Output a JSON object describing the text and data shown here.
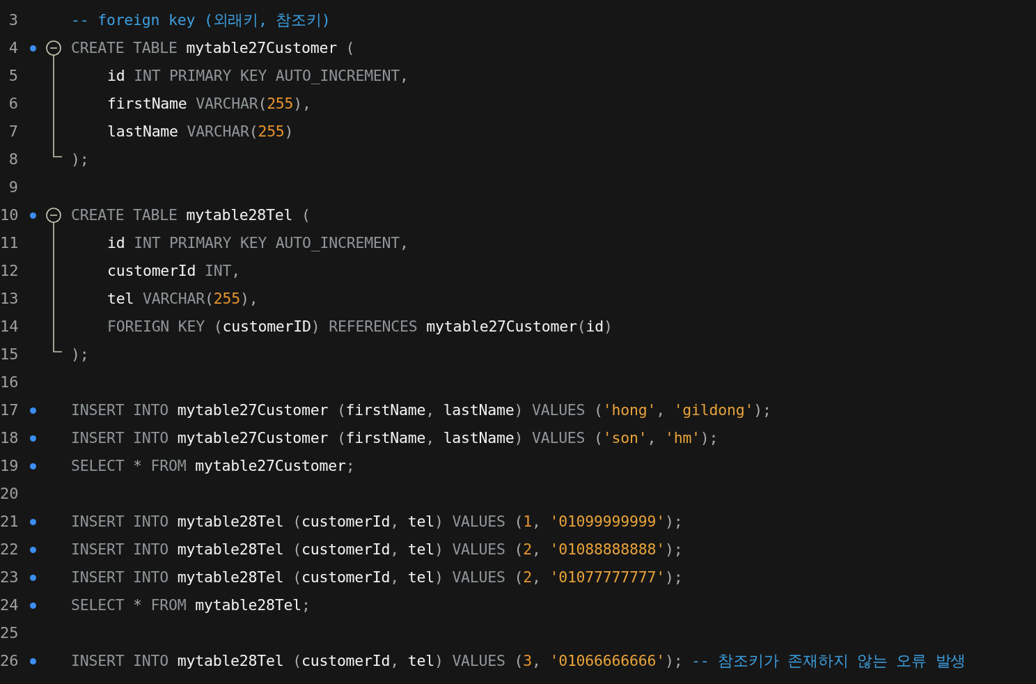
{
  "lines": [
    {
      "number": "3",
      "kind": "plain",
      "statement": false,
      "tokens": [
        {
          "kind": "comment",
          "t": "-- foreign key (외래키, 참조키)"
        }
      ]
    },
    {
      "number": "4",
      "kind": "fold-start",
      "statement": true,
      "tokens": [
        {
          "kind": "kw",
          "t": "CREATE TABLE "
        },
        {
          "kind": "id",
          "t": "mytable27Customer "
        },
        {
          "kind": "p",
          "t": "("
        }
      ]
    },
    {
      "number": "5",
      "kind": "fold-body",
      "statement": false,
      "tokens": [
        {
          "kind": "id",
          "t": "id "
        },
        {
          "kind": "kw",
          "t": "INT PRIMARY KEY AUTO_INCREMENT"
        },
        {
          "kind": "p",
          "t": ","
        }
      ]
    },
    {
      "number": "6",
      "kind": "fold-body",
      "statement": false,
      "tokens": [
        {
          "kind": "id",
          "t": "firstName "
        },
        {
          "kind": "kw",
          "t": "VARCHAR"
        },
        {
          "kind": "p",
          "t": "("
        },
        {
          "kind": "num",
          "t": "255"
        },
        {
          "kind": "p",
          "t": "),"
        }
      ]
    },
    {
      "number": "7",
      "kind": "fold-body",
      "statement": false,
      "tokens": [
        {
          "kind": "id",
          "t": "lastName "
        },
        {
          "kind": "kw",
          "t": "VARCHAR"
        },
        {
          "kind": "p",
          "t": "("
        },
        {
          "kind": "num",
          "t": "255"
        },
        {
          "kind": "p",
          "t": ")"
        }
      ]
    },
    {
      "number": "8",
      "kind": "fold-end",
      "statement": false,
      "tokens": [
        {
          "kind": "p",
          "t": ");"
        }
      ]
    },
    {
      "number": "9",
      "kind": "plain",
      "statement": false
    },
    {
      "number": "10",
      "kind": "fold-start",
      "statement": true,
      "tokens": [
        {
          "kind": "kw",
          "t": "CREATE TABLE "
        },
        {
          "kind": "id",
          "t": "mytable28Tel "
        },
        {
          "kind": "p",
          "t": "("
        }
      ]
    },
    {
      "number": "11",
      "kind": "fold-body",
      "statement": false,
      "tokens": [
        {
          "kind": "id",
          "t": "id "
        },
        {
          "kind": "kw",
          "t": "INT PRIMARY KEY AUTO_INCREMENT"
        },
        {
          "kind": "p",
          "t": ","
        }
      ]
    },
    {
      "number": "12",
      "kind": "fold-body",
      "statement": false,
      "tokens": [
        {
          "kind": "id",
          "t": "customerId "
        },
        {
          "kind": "kw",
          "t": "INT"
        },
        {
          "kind": "p",
          "t": ","
        }
      ]
    },
    {
      "number": "13",
      "kind": "fold-body",
      "statement": false,
      "tokens": [
        {
          "kind": "id",
          "t": "tel "
        },
        {
          "kind": "kw",
          "t": "VARCHAR"
        },
        {
          "kind": "p",
          "t": "("
        },
        {
          "kind": "num",
          "t": "255"
        },
        {
          "kind": "p",
          "t": "),"
        }
      ]
    },
    {
      "number": "14",
      "kind": "fold-body",
      "statement": false,
      "tokens": [
        {
          "kind": "kw",
          "t": "FOREIGN KEY "
        },
        {
          "kind": "p",
          "t": "("
        },
        {
          "kind": "id",
          "t": "customerID"
        },
        {
          "kind": "p",
          "t": ") "
        },
        {
          "kind": "kw",
          "t": "REFERENCES "
        },
        {
          "kind": "id",
          "t": "mytable27Customer"
        },
        {
          "kind": "p",
          "t": "("
        },
        {
          "kind": "id",
          "t": "id"
        },
        {
          "kind": "p",
          "t": ")"
        }
      ]
    },
    {
      "number": "15",
      "kind": "fold-end",
      "statement": false,
      "tokens": [
        {
          "kind": "p",
          "t": ");"
        }
      ]
    },
    {
      "number": "16",
      "kind": "plain",
      "statement": false
    },
    {
      "number": "17",
      "kind": "plain",
      "statement": true,
      "tokens": [
        {
          "kind": "kw",
          "t": "INSERT INTO "
        },
        {
          "kind": "id",
          "t": "mytable27Customer "
        },
        {
          "kind": "p",
          "t": "("
        },
        {
          "kind": "id",
          "t": "firstName"
        },
        {
          "kind": "p",
          "t": ", "
        },
        {
          "kind": "id",
          "t": "lastName"
        },
        {
          "kind": "p",
          "t": ") "
        },
        {
          "kind": "kw",
          "t": "VALUES "
        },
        {
          "kind": "p",
          "t": "("
        },
        {
          "kind": "str",
          "t": "'hong'"
        },
        {
          "kind": "p",
          "t": ", "
        },
        {
          "kind": "str",
          "t": "'gildong'"
        },
        {
          "kind": "p",
          "t": ");"
        }
      ]
    },
    {
      "number": "18",
      "kind": "plain",
      "statement": true,
      "tokens": [
        {
          "kind": "kw",
          "t": "INSERT INTO "
        },
        {
          "kind": "id",
          "t": "mytable27Customer "
        },
        {
          "kind": "p",
          "t": "("
        },
        {
          "kind": "id",
          "t": "firstName"
        },
        {
          "kind": "p",
          "t": ", "
        },
        {
          "kind": "id",
          "t": "lastName"
        },
        {
          "kind": "p",
          "t": ") "
        },
        {
          "kind": "kw",
          "t": "VALUES "
        },
        {
          "kind": "p",
          "t": "("
        },
        {
          "kind": "str",
          "t": "'son'"
        },
        {
          "kind": "p",
          "t": ", "
        },
        {
          "kind": "str",
          "t": "'hm'"
        },
        {
          "kind": "p",
          "t": ");"
        }
      ]
    },
    {
      "number": "19",
      "kind": "plain",
      "statement": true,
      "tokens": [
        {
          "kind": "kw",
          "t": "SELECT "
        },
        {
          "kind": "p",
          "t": "* "
        },
        {
          "kind": "kw",
          "t": "FROM "
        },
        {
          "kind": "id",
          "t": "mytable27Customer"
        },
        {
          "kind": "p",
          "t": ";"
        }
      ]
    },
    {
      "number": "20",
      "kind": "plain",
      "statement": false
    },
    {
      "number": "21",
      "kind": "plain",
      "statement": true,
      "tokens": [
        {
          "kind": "kw",
          "t": "INSERT INTO "
        },
        {
          "kind": "id",
          "t": "mytable28Tel "
        },
        {
          "kind": "p",
          "t": "("
        },
        {
          "kind": "id",
          "t": "customerId"
        },
        {
          "kind": "p",
          "t": ", "
        },
        {
          "kind": "id",
          "t": "tel"
        },
        {
          "kind": "p",
          "t": ") "
        },
        {
          "kind": "kw",
          "t": "VALUES "
        },
        {
          "kind": "p",
          "t": "("
        },
        {
          "kind": "num",
          "t": "1"
        },
        {
          "kind": "p",
          "t": ", "
        },
        {
          "kind": "str",
          "t": "'01099999999'"
        },
        {
          "kind": "p",
          "t": ");"
        }
      ]
    },
    {
      "number": "22",
      "kind": "plain",
      "statement": true,
      "tokens": [
        {
          "kind": "kw",
          "t": "INSERT INTO "
        },
        {
          "kind": "id",
          "t": "mytable28Tel "
        },
        {
          "kind": "p",
          "t": "("
        },
        {
          "kind": "id",
          "t": "customerId"
        },
        {
          "kind": "p",
          "t": ", "
        },
        {
          "kind": "id",
          "t": "tel"
        },
        {
          "kind": "p",
          "t": ") "
        },
        {
          "kind": "kw",
          "t": "VALUES "
        },
        {
          "kind": "p",
          "t": "("
        },
        {
          "kind": "num",
          "t": "2"
        },
        {
          "kind": "p",
          "t": ", "
        },
        {
          "kind": "str",
          "t": "'01088888888'"
        },
        {
          "kind": "p",
          "t": ");"
        }
      ]
    },
    {
      "number": "23",
      "kind": "plain",
      "statement": true,
      "tokens": [
        {
          "kind": "kw",
          "t": "INSERT INTO "
        },
        {
          "kind": "id",
          "t": "mytable28Tel "
        },
        {
          "kind": "p",
          "t": "("
        },
        {
          "kind": "id",
          "t": "customerId"
        },
        {
          "kind": "p",
          "t": ", "
        },
        {
          "kind": "id",
          "t": "tel"
        },
        {
          "kind": "p",
          "t": ") "
        },
        {
          "kind": "kw",
          "t": "VALUES "
        },
        {
          "kind": "p",
          "t": "("
        },
        {
          "kind": "num",
          "t": "2"
        },
        {
          "kind": "p",
          "t": ", "
        },
        {
          "kind": "str",
          "t": "'01077777777'"
        },
        {
          "kind": "p",
          "t": ");"
        }
      ]
    },
    {
      "number": "24",
      "kind": "plain",
      "statement": true,
      "tokens": [
        {
          "kind": "kw",
          "t": "SELECT "
        },
        {
          "kind": "p",
          "t": "* "
        },
        {
          "kind": "kw",
          "t": "FROM "
        },
        {
          "kind": "id",
          "t": "mytable28Tel"
        },
        {
          "kind": "p",
          "t": ";"
        }
      ]
    },
    {
      "number": "25",
      "kind": "plain",
      "statement": false
    },
    {
      "number": "26",
      "kind": "plain",
      "statement": true,
      "tokens": [
        {
          "kind": "kw",
          "t": "INSERT INTO "
        },
        {
          "kind": "id",
          "t": "mytable28Tel "
        },
        {
          "kind": "p",
          "t": "("
        },
        {
          "kind": "id",
          "t": "customerId"
        },
        {
          "kind": "p",
          "t": ", "
        },
        {
          "kind": "id",
          "t": "tel"
        },
        {
          "kind": "p",
          "t": ") "
        },
        {
          "kind": "kw",
          "t": "VALUES "
        },
        {
          "kind": "p",
          "t": "("
        },
        {
          "kind": "num",
          "t": "3"
        },
        {
          "kind": "p",
          "t": ", "
        },
        {
          "kind": "str",
          "t": "'01066666666'"
        },
        {
          "kind": "p",
          "t": "); "
        },
        {
          "kind": "comment",
          "t": "-- 참조키가 존재하지 않는 오류 발생"
        }
      ]
    }
  ]
}
